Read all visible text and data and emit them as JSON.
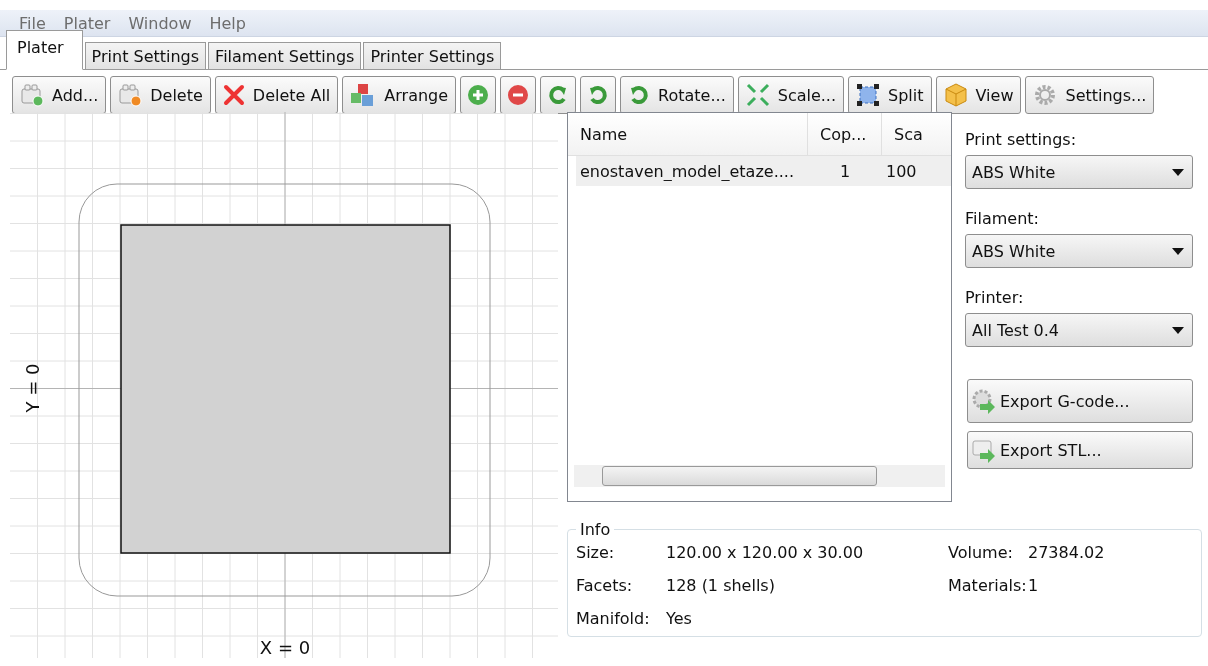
{
  "menu": [
    "File",
    "Plater",
    "Window",
    "Help"
  ],
  "tabs": [
    {
      "label": "Plater",
      "selected": true
    },
    {
      "label": "Print Settings",
      "selected": false
    },
    {
      "label": "Filament Settings",
      "selected": false
    },
    {
      "label": "Printer Settings",
      "selected": false
    }
  ],
  "toolbar": [
    {
      "kind": "labeled",
      "label": "Add..."
    },
    {
      "kind": "labeled",
      "label": "Delete"
    },
    {
      "kind": "labeled",
      "label": "Delete All"
    },
    {
      "kind": "labeled",
      "label": "Arrange"
    },
    {
      "kind": "icon_only"
    },
    {
      "kind": "icon_only"
    },
    {
      "kind": "icon_only"
    },
    {
      "kind": "icon_only"
    },
    {
      "kind": "labeled",
      "label": "Rotate..."
    },
    {
      "kind": "labeled",
      "label": "Scale..."
    },
    {
      "kind": "labeled",
      "label": "Split"
    },
    {
      "kind": "labeled",
      "label": "View"
    },
    {
      "kind": "labeled",
      "label": "Settings..."
    }
  ],
  "plater": {
    "x_axis_label": "X = 0",
    "y_axis_label": "Y = 0"
  },
  "object_list": {
    "columns": [
      "Name",
      "Cop...",
      "Sca"
    ],
    "rows": [
      {
        "cells": [
          "enostaven_model_etaze....",
          "1",
          "100"
        ],
        "selected": true
      }
    ]
  },
  "presets": [
    {
      "label": "Print settings:",
      "value": "ABS White"
    },
    {
      "label": "Filament:",
      "value": "ABS White"
    },
    {
      "label": "Printer:",
      "value": "All Test 0.4"
    }
  ],
  "export_buttons": [
    "Export G-code...",
    "Export STL..."
  ],
  "info": {
    "title": "Info",
    "fields": [
      {
        "label": "Size:",
        "value": "120.00 x 120.00 x 30.00"
      },
      {
        "label": "Volume:",
        "value": "27384.02"
      },
      {
        "label": "Facets:",
        "value": "128 (1 shells)"
      },
      {
        "label": "Materials:",
        "value": "1"
      },
      {
        "label": "Manifold:",
        "value": "Yes"
      }
    ]
  }
}
